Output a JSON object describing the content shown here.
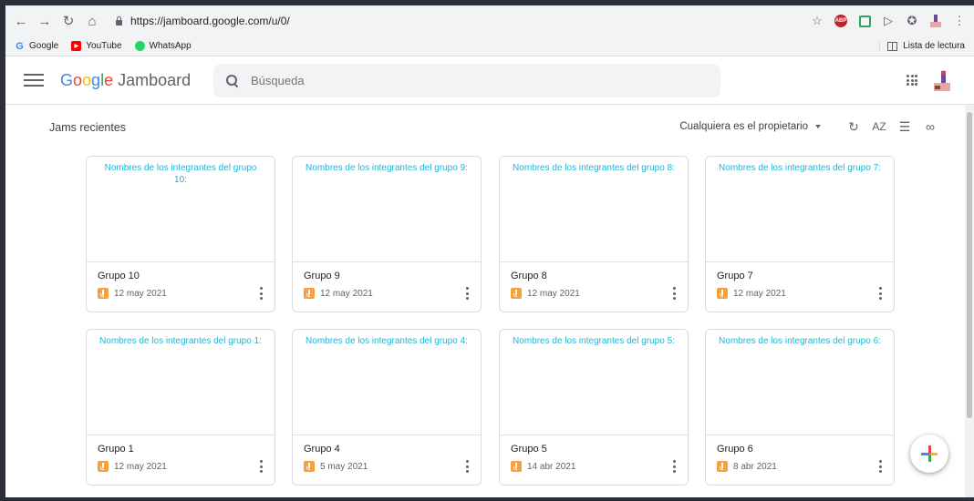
{
  "browser": {
    "url": "https://jamboard.google.com/u/0/",
    "bookmarks": [
      {
        "label": "Google",
        "icon": "google-icon"
      },
      {
        "label": "YouTube",
        "icon": "youtube-icon"
      },
      {
        "label": "WhatsApp",
        "icon": "whatsapp-icon"
      }
    ],
    "reading_list": "Lista de lectura"
  },
  "app": {
    "logo_google": [
      "G",
      "o",
      "o",
      "g",
      "l",
      "e"
    ],
    "logo_product": "Jamboard",
    "search_placeholder": "Búsqueda"
  },
  "main": {
    "section_title": "Jams recientes",
    "owner_filter": "Cualquiera es el propietario",
    "sort_icon_text": "AZ",
    "cards": [
      {
        "preview": "Nombres de los integrantes del grupo 10:",
        "title": "Grupo 10",
        "date": "12 may 2021"
      },
      {
        "preview": "Nombres de los integrantes del grupo 9:",
        "title": "Grupo 9",
        "date": "12 may 2021"
      },
      {
        "preview": "Nombres de los integrantes del grupo 8:",
        "title": "Grupo 8",
        "date": "12 may 2021"
      },
      {
        "preview": "Nombres de los integrantes del grupo 7:",
        "title": "Grupo 7",
        "date": "12 may 2021"
      },
      {
        "preview": "Nombres de los integrantes del grupo 1:",
        "title": "Grupo 1",
        "date": "12 may 2021"
      },
      {
        "preview": "Nombres de los integrantes del grupo 4:",
        "title": "Grupo 4",
        "date": "5 may 2021"
      },
      {
        "preview": "Nombres de los integrantes del grupo 5:",
        "title": "Grupo 5",
        "date": "14 abr 2021"
      },
      {
        "preview": "Nombres de los integrantes del grupo 6:",
        "title": "Grupo 6",
        "date": "8 abr 2021"
      }
    ]
  },
  "colors": {
    "preview_text": "#20b5d5",
    "jam_icon": "#f6a042"
  }
}
